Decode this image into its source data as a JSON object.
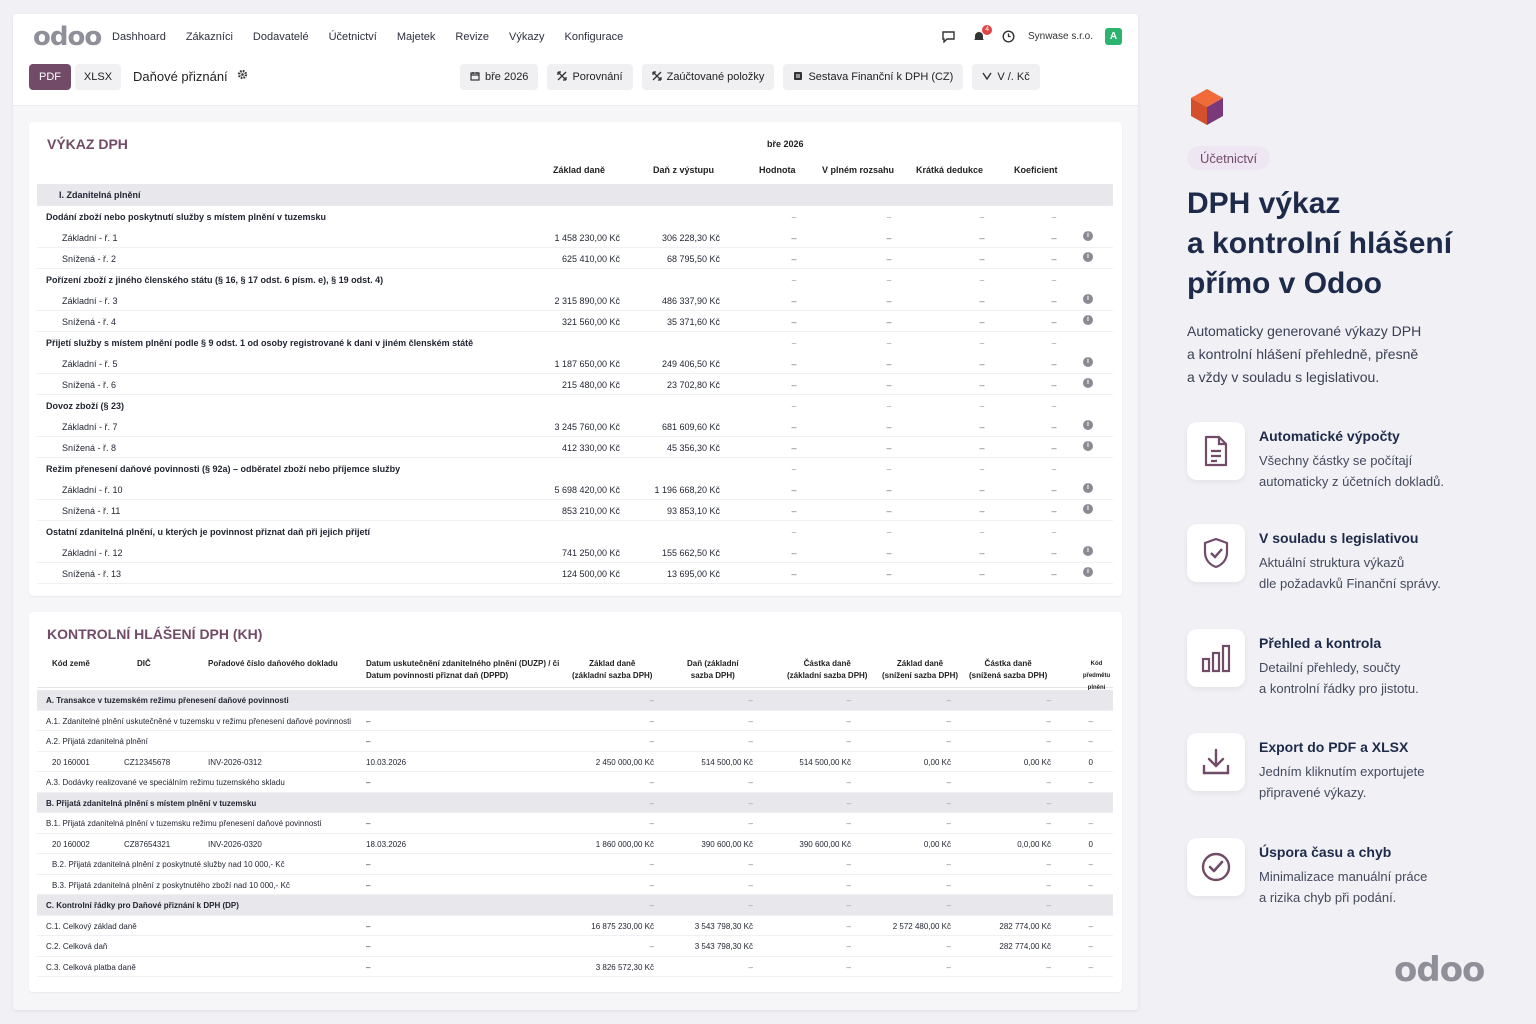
{
  "app": {
    "brand": "odoo",
    "menu": [
      "Dashhoard",
      "Zákazníci",
      "Dodavatelé",
      "Účetnictví",
      "Majetek",
      "Revize",
      "Výkazy",
      "Konfigurace"
    ],
    "notifications_count": "4",
    "company": "Synwase s.r.o.",
    "avatar_initial": "A"
  },
  "controls": {
    "pdf_label": "PDF",
    "xlsx_label": "XLSX",
    "report_title": "Daňové přiznání",
    "filters": [
      {
        "icon": "calendar-icon",
        "label": "bře 2026"
      },
      {
        "icon": "compare-icon",
        "label": "Porovnání"
      },
      {
        "icon": "posted-icon",
        "label": "Zaúčtované položky"
      },
      {
        "icon": "report-icon",
        "label": "Sestava Finanční k DPH (CZ)"
      },
      {
        "icon": "currency-icon",
        "label": "V /. Kč"
      }
    ]
  },
  "vat_report": {
    "title": "VÝKAZ DPH",
    "period": "bře 2026",
    "columns": [
      "Základ daně",
      "Daň z výstupu",
      "Hodnota",
      "V plném rozsahu",
      "Krátká dedukce",
      "Koeficient"
    ],
    "rows": [
      {
        "type": "sec",
        "label": "I. Zdanitelná plnění"
      },
      {
        "type": "grp",
        "label": "Dodání zboží nebo poskytnutí služby s místem plnění v tuzemsku"
      },
      {
        "type": "line",
        "label": "Základní - ř. 1",
        "base": "1 458 230,00 Kč",
        "tax": "306 228,30 Kč",
        "info": true
      },
      {
        "type": "line",
        "label": "Snížená - ř. 2",
        "base": "625 410,00 Kč",
        "tax": "68 795,50 Kč",
        "info": true
      },
      {
        "type": "grp",
        "label": "Pořízení zboží z jiného členského státu (§ 16, § 17 odst. 6 písm. e), § 19 odst. 4)"
      },
      {
        "type": "line",
        "label": "Základní - ř. 3",
        "base": "2 315 890,00 Kč",
        "tax": "486 337,90 Kč",
        "info": true
      },
      {
        "type": "line",
        "label": "Snížená - ř. 4",
        "base": "321 560,00 Kč",
        "tax": "35 371,60 Kč",
        "info": true
      },
      {
        "type": "grp",
        "label": "Přijetí služby s místem plnění podle § 9 odst. 1 od osoby registrované k dani v jiném členském státě"
      },
      {
        "type": "line",
        "label": "Základní - ř. 5",
        "base": "1 187 650,00 Kč",
        "tax": "249 406,50 Kč",
        "info": true
      },
      {
        "type": "line",
        "label": "Snížená - ř. 6",
        "base": "215 480,00 Kč",
        "tax": "23 702,80 Kč",
        "info": true
      },
      {
        "type": "grp",
        "label": "Dovoz zboží (§ 23)"
      },
      {
        "type": "line",
        "label": "Základní - ř. 7",
        "base": "3 245 760,00 Kč",
        "tax": "681 609,60 Kč",
        "info": true
      },
      {
        "type": "line",
        "label": "Snížená - ř. 8",
        "base": "412 330,00 Kč",
        "tax": "45 356,30 Kč",
        "info": true
      },
      {
        "type": "grp",
        "label": "Režim přenesení daňové povinnosti (§ 92a) – odběratel zboží nebo příjemce služby"
      },
      {
        "type": "line",
        "label": "Základní - ř. 10",
        "base": "5 698 420,00 Kč",
        "tax": "1 196 668,20 Kč",
        "info": true
      },
      {
        "type": "line",
        "label": "Snížená - ř. 11",
        "base": "853 210,00 Kč",
        "tax": "93 853,10 Kč",
        "info": true
      },
      {
        "type": "grp",
        "label": "Ostatní zdanitelná plnění, u kterých je povinnost přiznat daň při jejich přijetí"
      },
      {
        "type": "line",
        "label": "Základní - ř. 12",
        "base": "741 250,00 Kč",
        "tax": "155 662,50 Kč",
        "info": true
      },
      {
        "type": "line",
        "label": "Snížená - ř. 13",
        "base": "124 500,00 Kč",
        "tax": "13 695,00 Kč",
        "info": true
      }
    ]
  },
  "kh_report": {
    "title": "KONTROLNÍ HLÁŠENÍ DPH (KH)",
    "columns": [
      {
        "l1": "Kód země",
        "l2": ""
      },
      {
        "l1": "DIČ",
        "l2": ""
      },
      {
        "l1": "Pořadové číslo daňového dokladu",
        "l2": ""
      },
      {
        "l1": "Datum uskutečnění zdanitelného plnění (DUZP) / či",
        "l2": "Datum povinnosti přiznat daň (DPPD)"
      },
      {
        "l1": "Základ daně",
        "l2": "(základní sazba DPH)"
      },
      {
        "l1": "Daň (základní",
        "l2": "sazba DPH)"
      },
      {
        "l1": "Částka daně",
        "l2": "(základní sazba DPH)"
      },
      {
        "l1": "Základ daně",
        "l2": "(snížení sazba DPH)"
      },
      {
        "l1": "Částka daně",
        "l2": "(snížená sazba DPH)"
      },
      {
        "l1": "Kód",
        "l2": "předmětu plnění"
      }
    ],
    "rows": [
      {
        "type": "sec",
        "label": "A. Transakce v tuzemském režimu přenesení daňové povinnosti"
      },
      {
        "type": "line",
        "label": "A.1. Zdanitelné plnění uskutečněné v tuzemsku v režimu přenesení daňové povinnosti",
        "date": "–",
        "c1": "–",
        "c2": "–",
        "c3": "–",
        "c4": "–",
        "c5": "–",
        "code": "–"
      },
      {
        "type": "line",
        "label": "A.2. Přijatá zdanitelná plnění",
        "date": "–",
        "c1": "–",
        "c2": "–",
        "c3": "–",
        "c4": "–",
        "c5": "–",
        "code": "–"
      },
      {
        "type": "data",
        "country": "20 160001",
        "vat": "CZ12345678",
        "doc": "INV-2026-0312",
        "date": "10.03.2026",
        "c1": "2 450 000,00 Kč",
        "c2": "514 500,00 Kč",
        "c3": "514 500,00 Kč",
        "c4": "0,00 Kč",
        "c5": "0,00 Kč",
        "code": "0"
      },
      {
        "type": "line",
        "label": "A.3. Dodávky realizované ve speciálním režimu tuzemského skladu",
        "date": "–",
        "c1": "–",
        "c2": "–",
        "c3": "–",
        "c4": "–",
        "c5": "–",
        "code": "–"
      },
      {
        "type": "sec",
        "label": "B. Přijatá zdanitelná plnění s místem plnění v tuzemsku"
      },
      {
        "type": "line",
        "label": "B.1. Přijatá zdanitelná plnění v tuzemsku režimu přenesení daňové povinnosti",
        "date": "–",
        "c1": "–",
        "c2": "–",
        "c3": "–",
        "c4": "–",
        "c5": "–",
        "code": "–"
      },
      {
        "type": "data",
        "country": "20 160002",
        "vat": "CZ87654321",
        "doc": "INV-2026-0320",
        "date": "18.03.2026",
        "c1": "1 860 000,00 Kč",
        "c2": "390 600,00 Kč",
        "c3": "390 600,00 Kč",
        "c4": "0,00 Kč",
        "c5": "0,0,00 Kč",
        "code": "0"
      },
      {
        "type": "line",
        "indent": true,
        "label": "B.2. Přijatá zdanitelná plnění z poskytnuté služby nad 10 000,- Kč",
        "date": "–",
        "c1": "–",
        "c2": "–",
        "c3": "–",
        "c4": "–",
        "c5": "–",
        "code": "–"
      },
      {
        "type": "line",
        "indent": true,
        "label": "B.3. Přijatá zdanitelná plnění z poskytnutého zboží nad 10 000,- Kč",
        "date": "–",
        "c1": "–",
        "c2": "–",
        "c3": "–",
        "c4": "–",
        "c5": "–",
        "code": "–"
      },
      {
        "type": "sec",
        "label": "C. Kontrolní řádky pro Daňové přiznání k DPH (DP)"
      },
      {
        "type": "line",
        "label": "C.1. Celkový základ daně",
        "date": "–",
        "c1": "16 875 230,00 Kč",
        "c2": "3 543 798,30 Kč",
        "c3": "–",
        "c4": "2 572 480,00 Kč",
        "c5": "282 774,00 Kč",
        "code": "–"
      },
      {
        "type": "line",
        "label": "C.2. Celková daň",
        "date": "–",
        "c1": "–",
        "c2": "3 543 798,30 Kč",
        "c3": "–",
        "c4": "–",
        "c5": "282 774,00 Kč",
        "code": "–"
      },
      {
        "type": "line",
        "label": "C.3. Celková platba daně",
        "date": "–",
        "c1": "3 826 572,30 Kč",
        "c2": "–",
        "c3": "–",
        "c4": "–",
        "c5": "–",
        "code": "–"
      }
    ]
  },
  "marketing": {
    "tag": "Účetnictví",
    "headline_lines": [
      "DPH výkaz",
      "a kontrolní hlášení",
      "přímo v Odoo"
    ],
    "lead_lines": [
      "Automaticky generované výkazy DPH",
      "a kontrolní hlášení přehledně, přesně",
      "a vždy v souladu s legislativou."
    ],
    "features": [
      {
        "icon": "document-icon",
        "title": "Automatické výpočty",
        "desc": [
          "Všechny částky se počítají",
          "automaticky z účetních dokladů."
        ]
      },
      {
        "icon": "shield-check-icon",
        "title": "V souladu s legislativou",
        "desc": [
          "Aktuální struktura výkazů",
          "dle požadavků Finanční správy."
        ]
      },
      {
        "icon": "bar-chart-icon",
        "title": "Přehled a kontrola",
        "desc": [
          "Detailní přehledy, součty",
          "a kontrolní řádky pro jistotu."
        ]
      },
      {
        "icon": "download-icon",
        "title": "Export do PDF a XLSX",
        "desc": [
          "Jedním kliknutím exportujete",
          "připravené výkazy."
        ]
      },
      {
        "icon": "check-circle-icon",
        "title": "Úspora času a chyb",
        "desc": [
          "Minimalizace manuální práce",
          "a rizika chyb při podání."
        ]
      }
    ],
    "brand": "odoo"
  },
  "colors": {
    "brand_purple": "#714b67",
    "navy": "#1d2a4a",
    "section_bg": "#e8e8ec"
  }
}
